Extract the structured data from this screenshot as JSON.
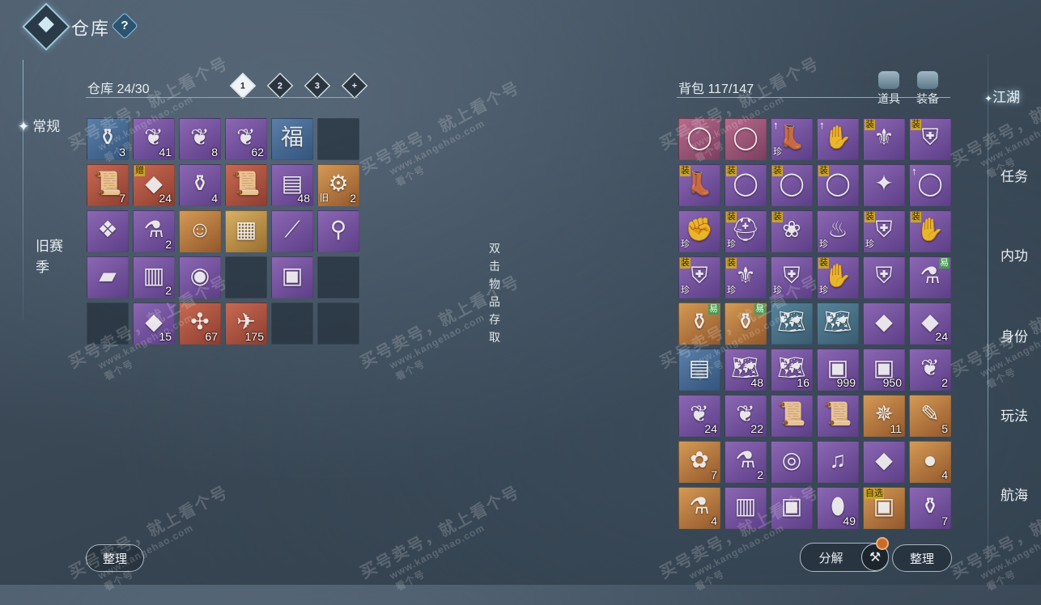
{
  "header": {
    "title": "仓库",
    "help": "?"
  },
  "left_nav": [
    {
      "label": "常规",
      "active": true
    },
    {
      "label": "旧赛季",
      "active": false
    }
  ],
  "right_nav": [
    {
      "label": "江湖",
      "active": true
    },
    {
      "label": "任务",
      "active": false
    },
    {
      "label": "内功",
      "active": false
    },
    {
      "label": "身份",
      "active": false
    },
    {
      "label": "玩法",
      "active": false
    },
    {
      "label": "航海",
      "active": false
    }
  ],
  "warehouse": {
    "label": "仓库 24/30",
    "tabs": [
      "1",
      "2",
      "3",
      "+"
    ],
    "slots": [
      {
        "icon": "vase-icon",
        "glyph": "⚱",
        "rarity": "blue",
        "count": "3"
      },
      {
        "icon": "coral-icon",
        "glyph": "❦",
        "rarity": "purple",
        "count": "41"
      },
      {
        "icon": "coral-icon",
        "glyph": "❦",
        "rarity": "purple",
        "count": "8"
      },
      {
        "icon": "coral-icon",
        "glyph": "❦",
        "rarity": "purple",
        "count": "62"
      },
      {
        "icon": "fortune-icon",
        "glyph": "福",
        "rarity": "blue",
        "count": ""
      },
      {
        "icon": "",
        "glyph": "",
        "rarity": "empty",
        "count": ""
      },
      {
        "icon": "scroll-icon",
        "glyph": "📜",
        "rarity": "red",
        "count": "7"
      },
      {
        "icon": "ore-icon",
        "glyph": "◆",
        "rarity": "red",
        "count": "24",
        "badge": "赠"
      },
      {
        "icon": "vase-icon",
        "glyph": "⚱",
        "rarity": "purple",
        "count": "4"
      },
      {
        "icon": "scroll-icon",
        "glyph": "📜",
        "rarity": "red",
        "count": ""
      },
      {
        "icon": "book-icon",
        "glyph": "▤",
        "rarity": "purple",
        "count": "48"
      },
      {
        "icon": "handle-icon",
        "glyph": "⚙",
        "rarity": "orange",
        "count": "2",
        "tag": "旧"
      },
      {
        "icon": "ribbon-icon",
        "glyph": "❖",
        "rarity": "purple",
        "count": ""
      },
      {
        "icon": "jar-icon",
        "glyph": "⚗",
        "rarity": "purple",
        "count": "2"
      },
      {
        "icon": "portrait-icon",
        "glyph": "☺",
        "rarity": "orange",
        "count": ""
      },
      {
        "icon": "tablet-icon",
        "glyph": "▦",
        "rarity": "gold",
        "count": ""
      },
      {
        "icon": "spear-icon",
        "glyph": "⟋",
        "rarity": "purple",
        "count": ""
      },
      {
        "icon": "hook-icon",
        "glyph": "⚲",
        "rarity": "purple",
        "count": ""
      },
      {
        "icon": "ingot-icon",
        "glyph": "▰",
        "rarity": "purple",
        "count": ""
      },
      {
        "icon": "manual-icon",
        "glyph": "▥",
        "rarity": "purple",
        "count": "2"
      },
      {
        "icon": "orb-icon",
        "glyph": "◉",
        "rarity": "purple",
        "count": ""
      },
      {
        "icon": "",
        "glyph": "",
        "rarity": "empty",
        "count": ""
      },
      {
        "icon": "box-icon",
        "glyph": "▣",
        "rarity": "purple",
        "count": ""
      },
      {
        "icon": "",
        "glyph": "",
        "rarity": "empty",
        "count": ""
      },
      {
        "icon": "",
        "glyph": "",
        "rarity": "empty",
        "count": ""
      },
      {
        "icon": "ore-icon",
        "glyph": "◆",
        "rarity": "purple",
        "count": "15"
      },
      {
        "icon": "dragonfly-icon",
        "glyph": "✣",
        "rarity": "red",
        "count": "67"
      },
      {
        "icon": "crane-icon",
        "glyph": "✈",
        "rarity": "red",
        "count": "175"
      },
      {
        "icon": "",
        "glyph": "",
        "rarity": "empty",
        "count": ""
      },
      {
        "icon": "",
        "glyph": "",
        "rarity": "empty",
        "count": ""
      }
    ],
    "sort_button": "整理"
  },
  "hint": [
    "双",
    "击",
    "物",
    "品",
    "存",
    "取"
  ],
  "bag": {
    "label": "背包 117/147",
    "tabs": [
      {
        "label": "道具",
        "icon": "bag-icon"
      },
      {
        "label": "装备",
        "icon": "armor-icon"
      }
    ],
    "slots": [
      {
        "icon": "ring-icon",
        "glyph": "◯",
        "rarity": "pink",
        "count": ""
      },
      {
        "icon": "ring-icon",
        "glyph": "◯",
        "rarity": "pink",
        "count": ""
      },
      {
        "icon": "boots-icon",
        "glyph": "👢",
        "rarity": "purple",
        "count": "",
        "badge": "↑",
        "tag": "珍"
      },
      {
        "icon": "glove-icon",
        "glyph": "✋",
        "rarity": "purple",
        "count": "",
        "badge": "↑"
      },
      {
        "icon": "belt-icon",
        "glyph": "⚜",
        "rarity": "purple",
        "count": "",
        "badge": "装"
      },
      {
        "icon": "armor-icon",
        "glyph": "⛨",
        "rarity": "purple",
        "count": "",
        "badge": "装"
      },
      {
        "icon": "boots-icon",
        "glyph": "👢",
        "rarity": "purple",
        "count": "",
        "badge": "装"
      },
      {
        "icon": "ring-icon",
        "glyph": "◯",
        "rarity": "purple",
        "count": "",
        "badge": "装"
      },
      {
        "icon": "ring-icon",
        "glyph": "◯",
        "rarity": "purple",
        "count": "",
        "badge": "装"
      },
      {
        "icon": "ring-icon",
        "glyph": "◯",
        "rarity": "purple",
        "count": "",
        "badge": "装"
      },
      {
        "icon": "bracer-icon",
        "glyph": "✦",
        "rarity": "purple",
        "count": ""
      },
      {
        "icon": "bracelet-icon",
        "glyph": "◯",
        "rarity": "purple",
        "count": "",
        "badge": "↑"
      },
      {
        "icon": "gauntlet-icon",
        "glyph": "✊",
        "rarity": "purple",
        "count": "",
        "tag": "珍"
      },
      {
        "icon": "helmet-icon",
        "glyph": "⛑",
        "rarity": "purple",
        "count": "",
        "badge": "装",
        "tag": "珍"
      },
      {
        "icon": "necklace-icon",
        "glyph": "❀",
        "rarity": "purple",
        "count": "",
        "badge": "装"
      },
      {
        "icon": "pot-icon",
        "glyph": "♨",
        "rarity": "purple",
        "count": "",
        "tag": "珍"
      },
      {
        "icon": "armor-icon",
        "glyph": "⛨",
        "rarity": "purple",
        "count": "",
        "badge": "装",
        "tag": "珍"
      },
      {
        "icon": "glove-icon",
        "glyph": "✋",
        "rarity": "purple",
        "count": "",
        "badge": "装"
      },
      {
        "icon": "robe-icon",
        "glyph": "⛨",
        "rarity": "purple",
        "count": "",
        "badge": "装",
        "tag": "珍"
      },
      {
        "icon": "belt-icon",
        "glyph": "⚜",
        "rarity": "purple",
        "count": "",
        "badge": "装",
        "tag": "珍"
      },
      {
        "icon": "armor-icon",
        "glyph": "⛨",
        "rarity": "purple",
        "count": "",
        "tag": "珍"
      },
      {
        "icon": "glove-icon",
        "glyph": "✋",
        "rarity": "purple",
        "count": "",
        "badge": "装",
        "tag": "珍"
      },
      {
        "icon": "shoulder-icon",
        "glyph": "⛨",
        "rarity": "purple",
        "count": ""
      },
      {
        "icon": "gourd-icon",
        "glyph": "⚗",
        "rarity": "purple",
        "count": "",
        "badge": "易",
        "badgeColor": "green"
      },
      {
        "icon": "pouch-icon",
        "glyph": "⚱",
        "rarity": "orange",
        "count": "",
        "badge": "易",
        "badgeColor": "green"
      },
      {
        "icon": "pouch-icon",
        "glyph": "⚱",
        "rarity": "orange",
        "count": "",
        "badge": "易",
        "badgeColor": "green"
      },
      {
        "icon": "map-icon",
        "glyph": "🗺",
        "rarity": "teal",
        "count": ""
      },
      {
        "icon": "map-icon",
        "glyph": "🗺",
        "rarity": "teal",
        "count": ""
      },
      {
        "icon": "gem-icon",
        "glyph": "◆",
        "rarity": "purple",
        "count": ""
      },
      {
        "icon": "fire-gem-icon",
        "glyph": "◆",
        "rarity": "purple",
        "count": "24"
      },
      {
        "icon": "card-icon",
        "glyph": "▤",
        "rarity": "blue",
        "count": ""
      },
      {
        "icon": "map-icon",
        "glyph": "🗺",
        "rarity": "purple",
        "count": "48"
      },
      {
        "icon": "map-icon",
        "glyph": "🗺",
        "rarity": "purple",
        "count": "16"
      },
      {
        "icon": "chest-icon",
        "glyph": "▣",
        "rarity": "purple",
        "count": "999"
      },
      {
        "icon": "chest-icon",
        "glyph": "▣",
        "rarity": "purple",
        "count": "950"
      },
      {
        "icon": "coral-icon",
        "glyph": "❦",
        "rarity": "purple",
        "count": "2"
      },
      {
        "icon": "coral-icon",
        "glyph": "❦",
        "rarity": "purple",
        "count": "24"
      },
      {
        "icon": "coral-icon",
        "glyph": "❦",
        "rarity": "purple",
        "count": "22"
      },
      {
        "icon": "scroll-icon",
        "glyph": "📜",
        "rarity": "purple",
        "count": ""
      },
      {
        "icon": "scroll-icon",
        "glyph": "📜",
        "rarity": "purple",
        "count": ""
      },
      {
        "icon": "compass-icon",
        "glyph": "✵",
        "rarity": "orange",
        "count": "11"
      },
      {
        "icon": "brush-icon",
        "glyph": "✎",
        "rarity": "orange",
        "count": "5"
      },
      {
        "icon": "flower-icon",
        "glyph": "✿",
        "rarity": "orange",
        "count": "7"
      },
      {
        "icon": "bottle-icon",
        "glyph": "⚗",
        "rarity": "purple",
        "count": "2"
      },
      {
        "icon": "disc-icon",
        "glyph": "◎",
        "rarity": "purple",
        "count": ""
      },
      {
        "icon": "instrument-icon",
        "glyph": "♫",
        "rarity": "purple",
        "count": ""
      },
      {
        "icon": "stone-icon",
        "glyph": "◆",
        "rarity": "purple",
        "count": ""
      },
      {
        "icon": "pearl-icon",
        "glyph": "●",
        "rarity": "orange",
        "count": "4"
      },
      {
        "icon": "bottle-icon",
        "glyph": "⚗",
        "rarity": "orange",
        "count": "4"
      },
      {
        "icon": "paper-icon",
        "glyph": "▥",
        "rarity": "purple",
        "count": ""
      },
      {
        "icon": "box-icon",
        "glyph": "▣",
        "rarity": "purple",
        "count": ""
      },
      {
        "icon": "egg-icon",
        "glyph": "⬮",
        "rarity": "purple",
        "count": "49"
      },
      {
        "icon": "chest-icon",
        "glyph": "▣",
        "rarity": "orange",
        "count": "",
        "badge": "自选"
      },
      {
        "icon": "vase-icon",
        "glyph": "⚱",
        "rarity": "purple",
        "count": "7"
      }
    ],
    "decompose_button": "分解",
    "sort_button": "整理"
  },
  "watermark": {
    "line1": "买号卖号，就上看个号",
    "line2": "www.kangehao.com",
    "line3": "看个号"
  }
}
